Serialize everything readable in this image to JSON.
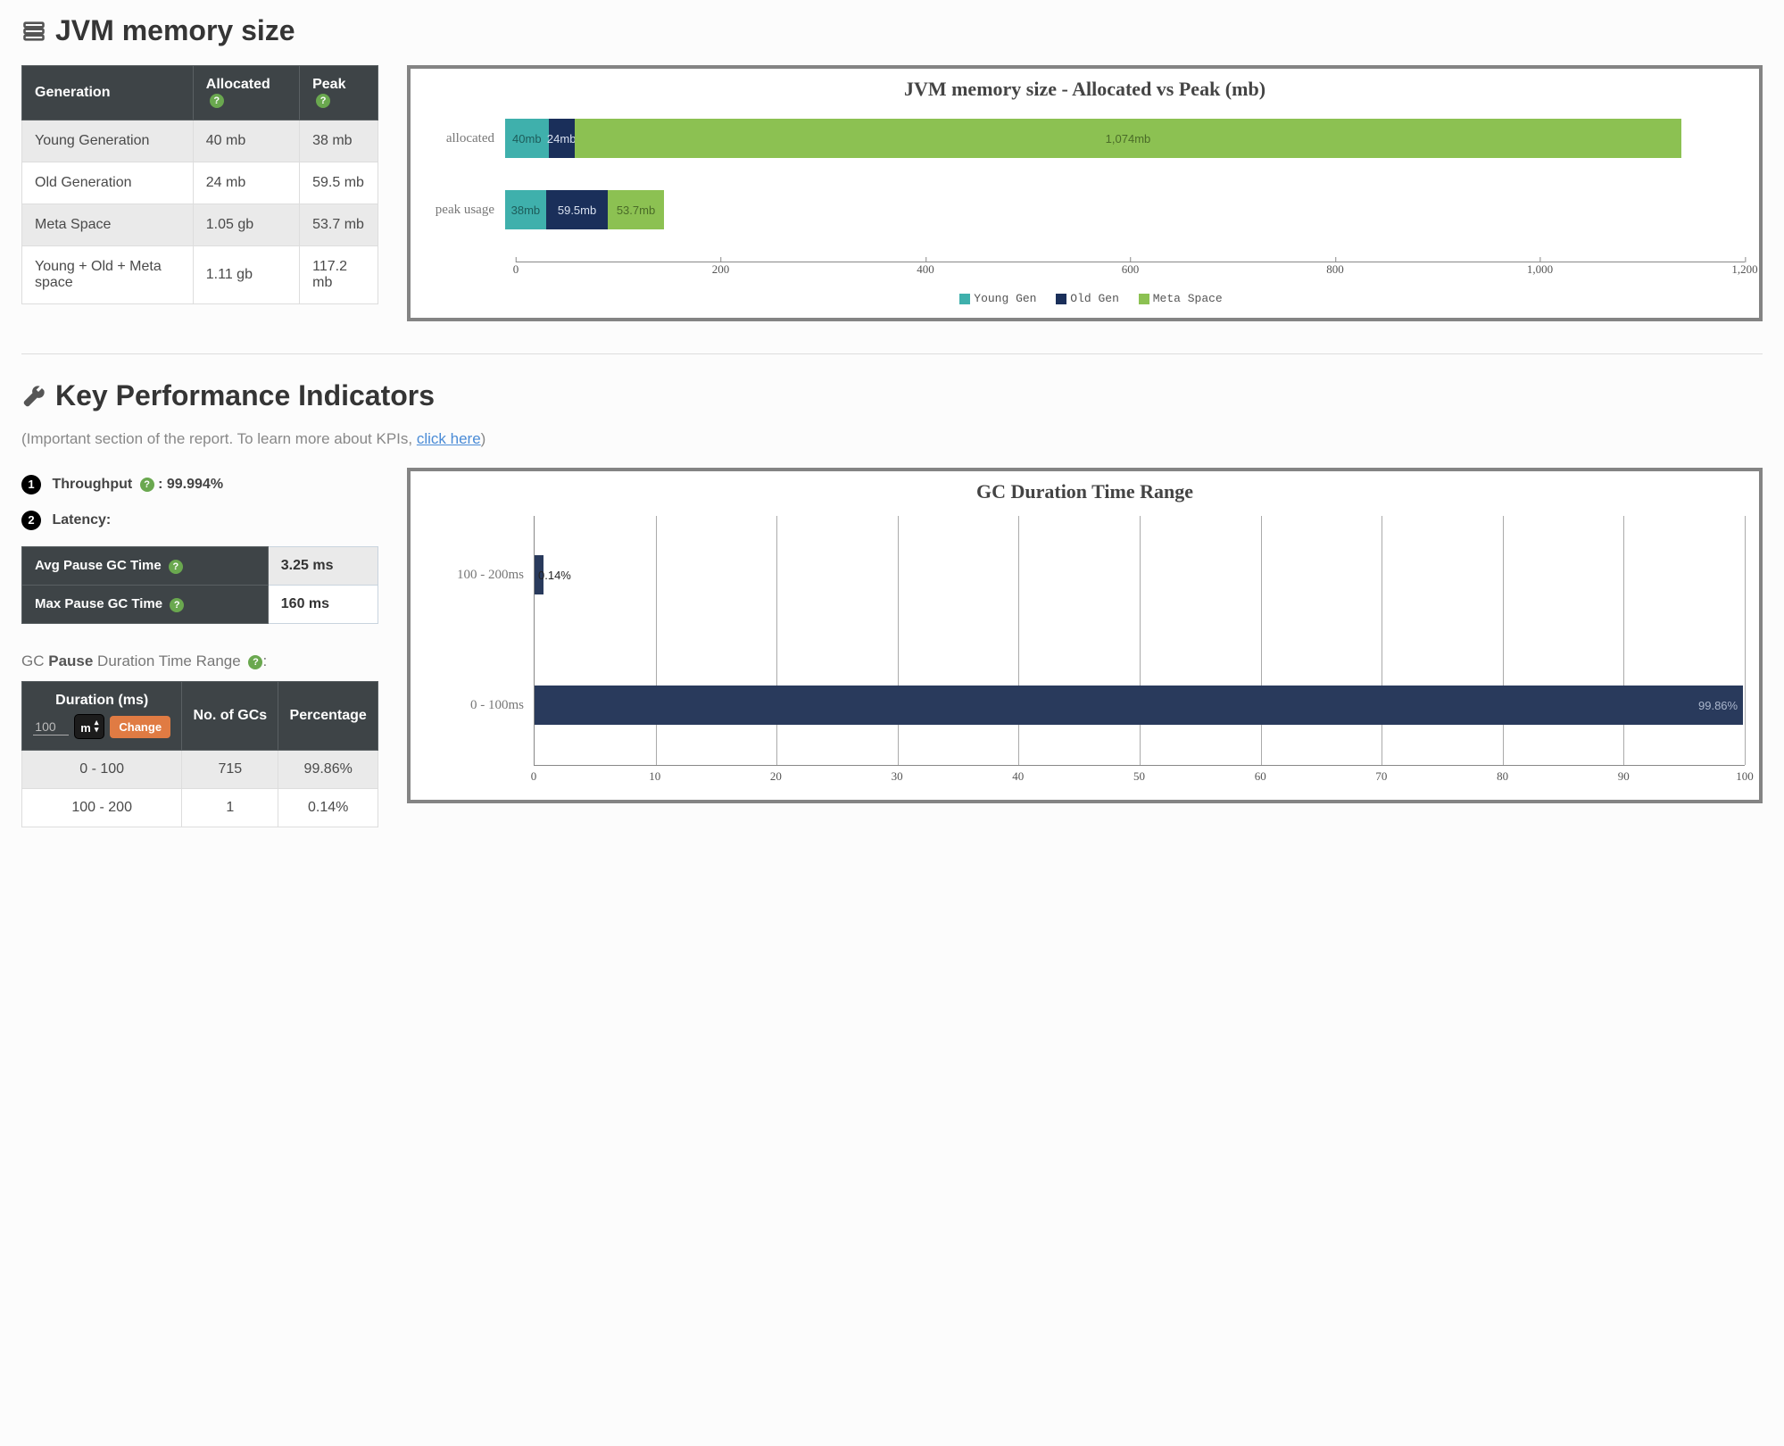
{
  "sections": {
    "memory": {
      "title": "JVM memory size",
      "table": {
        "headers": [
          "Generation",
          "Allocated",
          "Peak"
        ],
        "rows": [
          {
            "gen": "Young Generation",
            "alloc": "40 mb",
            "peak": "38 mb"
          },
          {
            "gen": "Old Generation",
            "alloc": "24 mb",
            "peak": "59.5 mb"
          },
          {
            "gen": "Meta Space",
            "alloc": "1.05 gb",
            "peak": "53.7 mb"
          },
          {
            "gen": "Young + Old + Meta space",
            "alloc": "1.11 gb",
            "peak": "117.2 mb"
          }
        ]
      },
      "chart_title": "JVM memory size - Allocated vs Peak (mb)",
      "legend": {
        "young": "Young Gen",
        "old": "Old Gen",
        "meta": "Meta Space"
      },
      "axis_ticks": [
        "0",
        "200",
        "400",
        "600",
        "800",
        "1,000",
        "1,200"
      ],
      "rows": {
        "allocated": {
          "label": "allocated",
          "young": "40mb",
          "old": "24mb",
          "meta": "1,074mb"
        },
        "peak": {
          "label": "peak usage",
          "young": "38mb",
          "old": "59.5mb",
          "meta": "53.7mb"
        }
      }
    },
    "kpi": {
      "title": "Key Performance Indicators",
      "note_prefix": "(Important section of the report. To learn more about KPIs, ",
      "note_link": "click here",
      "note_suffix": ")",
      "throughput_label": "Throughput",
      "throughput_value": ": 99.994%",
      "latency_label": "Latency:",
      "pause": {
        "avg_label": "Avg Pause GC Time",
        "avg_value": "3.25 ms",
        "max_label": "Max Pause GC Time",
        "max_value": "160 ms"
      },
      "range_label_pre": "GC ",
      "range_label_bold": "Pause",
      "range_label_post": " Duration Time Range",
      "dur_table": {
        "h1": "Duration (ms)",
        "h2": "No. of GCs",
        "h3": "Percentage",
        "input_value": "100",
        "unit": "m",
        "change": "Change",
        "rows": [
          {
            "dur": "0 - 100",
            "n": "715",
            "pct": "99.86%"
          },
          {
            "dur": "100 - 200",
            "n": "1",
            "pct": "0.14%"
          }
        ]
      },
      "chart_title": "GC Duration Time Range",
      "chart_rows": {
        "r1": {
          "label": "100 - 200ms",
          "pct": "0.14%"
        },
        "r2": {
          "label": "0 - 100ms",
          "pct": "99.86%"
        }
      },
      "axis_ticks": [
        "0",
        "10",
        "20",
        "30",
        "40",
        "50",
        "60",
        "70",
        "80",
        "90",
        "100"
      ]
    }
  },
  "chart_data": [
    {
      "type": "bar",
      "orientation": "horizontal-stacked",
      "title": "JVM memory size - Allocated vs Peak (mb)",
      "xlabel": "",
      "ylabel": "",
      "xlim": [
        0,
        1200
      ],
      "categories": [
        "allocated",
        "peak usage"
      ],
      "series": [
        {
          "name": "Young Gen",
          "values": [
            40,
            38
          ]
        },
        {
          "name": "Old Gen",
          "values": [
            24,
            59.5
          ]
        },
        {
          "name": "Meta Space",
          "values": [
            1074,
            53.7
          ]
        }
      ]
    },
    {
      "type": "bar",
      "orientation": "horizontal",
      "title": "GC Duration Time Range",
      "xlabel": "",
      "ylabel": "",
      "xlim": [
        0,
        100
      ],
      "categories": [
        "100 - 200ms",
        "0 - 100ms"
      ],
      "values": [
        0.14,
        99.86
      ]
    }
  ]
}
